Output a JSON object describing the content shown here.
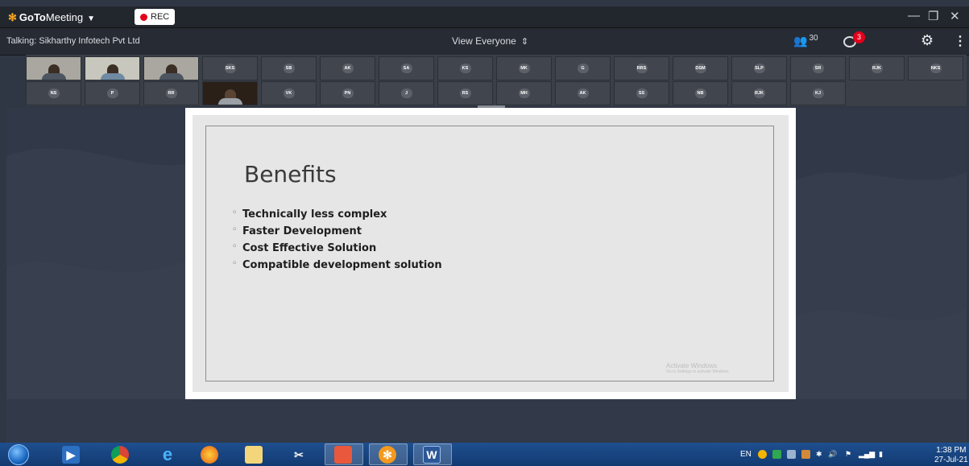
{
  "app": {
    "brand_prefix": "GoTo",
    "brand_suffix": "Meeting",
    "rec_label": "REC"
  },
  "infobar": {
    "talking": "Talking: Sikharthy Infotech Pvt Ltd",
    "view_label": "View Everyone",
    "attendee_count": "30",
    "chat_badge": "3"
  },
  "participants": {
    "row1": [
      "",
      "",
      "",
      "SKS",
      "SB",
      "AK",
      "SA",
      "KS",
      "MK",
      "G",
      "RRS",
      "DSM",
      "SLP",
      "SR",
      "RJK",
      "NKS"
    ],
    "row2": [
      "NS",
      "P",
      "RR",
      "",
      "VK",
      "PN",
      "J",
      "RS",
      "MH",
      "AK",
      "SS",
      "NB",
      "RJK",
      "KJ"
    ]
  },
  "slide": {
    "title": "Benefits",
    "bullets": [
      "Technically less complex",
      "Faster Development",
      "Cost Effective Solution",
      "Compatible development solution"
    ],
    "watermark_line1": "Activate Windows",
    "watermark_line2": "Go to Settings to activate Windows."
  },
  "taskbar": {
    "language": "EN",
    "time": "1:38 PM",
    "date": "27-Jul-21",
    "apps": [
      "start-orb",
      "media-player",
      "chrome",
      "internet-explorer",
      "firefox",
      "file-explorer",
      "snipping-tool",
      "goto-meeting-task",
      "goto-meeting",
      "microsoft-word"
    ]
  }
}
